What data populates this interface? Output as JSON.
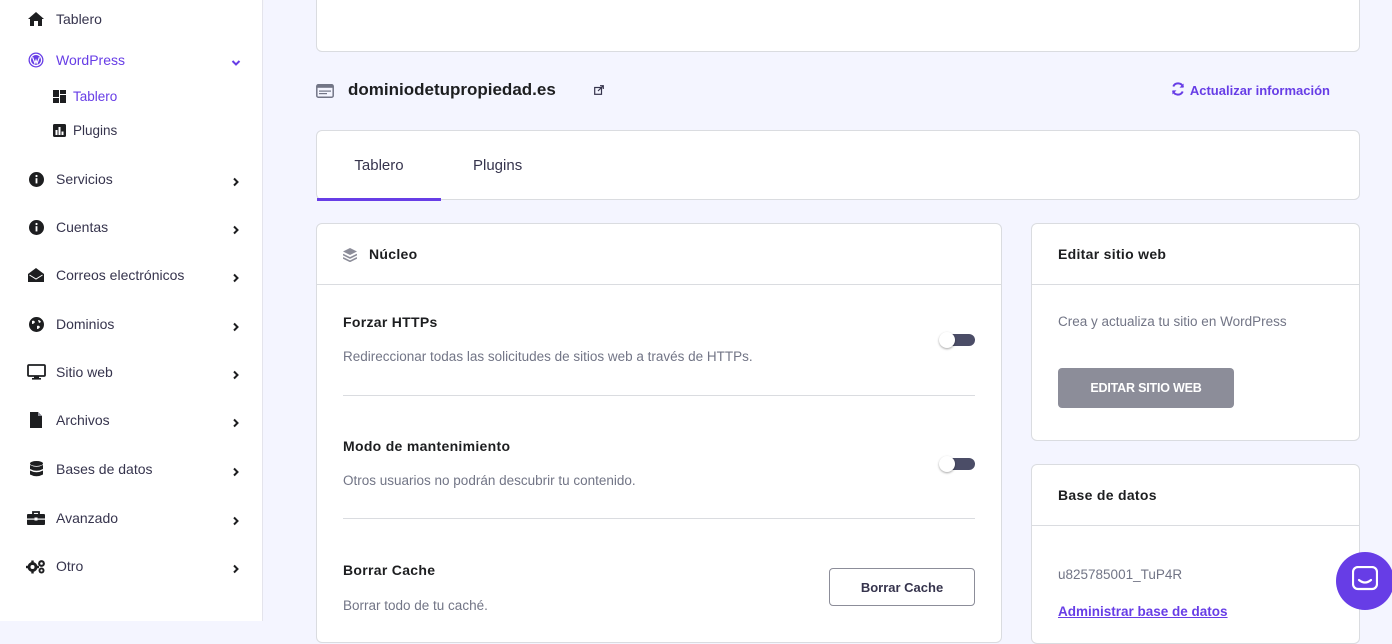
{
  "sidebar": {
    "items": [
      {
        "label": "Tablero",
        "icon": "home-icon"
      },
      {
        "label": "WordPress",
        "icon": "wordpress-icon"
      },
      {
        "label": "Servicios",
        "icon": "info-icon"
      },
      {
        "label": "Cuentas",
        "icon": "info-icon"
      },
      {
        "label": "Correos electrónicos",
        "icon": "envelope-open-icon"
      },
      {
        "label": "Dominios",
        "icon": "globe-icon"
      },
      {
        "label": "Sitio web",
        "icon": "monitor-icon"
      },
      {
        "label": "Archivos",
        "icon": "file-icon"
      },
      {
        "label": "Bases de datos",
        "icon": "database-icon"
      },
      {
        "label": "Avanzado",
        "icon": "toolbox-icon"
      },
      {
        "label": "Otro",
        "icon": "gears-icon"
      }
    ],
    "wordpress_sub": [
      {
        "label": "Tablero",
        "icon": "dashboard-icon"
      },
      {
        "label": "Plugins",
        "icon": "chart-icon"
      }
    ]
  },
  "header": {
    "domain": "dominiodetupropiedad.es",
    "refresh_label": "Actualizar información"
  },
  "tabs": [
    {
      "label": "Tablero",
      "active": true
    },
    {
      "label": "Plugins",
      "active": false
    }
  ],
  "core": {
    "title": "Núcleo",
    "options": [
      {
        "title": "Forzar HTTPs",
        "desc": "Redireccionar todas las solicitudes de sitios web a través de HTTPs.",
        "enabled": false
      },
      {
        "title": "Modo de mantenimiento",
        "desc": "Otros usuarios no podrán descubrir tu contenido.",
        "enabled": false
      },
      {
        "title": "Borrar Cache",
        "desc": "Borrar todo de tu caché.",
        "button": "Borrar Cache"
      }
    ]
  },
  "edit_site": {
    "title": "Editar sitio web",
    "desc": "Crea y actualiza tu sitio en WordPress",
    "button": "EDITAR SITIO WEB"
  },
  "database": {
    "title": "Base de datos",
    "name": "u825785001_TuP4R",
    "link": "Administrar base de datos"
  },
  "colors": {
    "accent": "#673de6",
    "text": "#36344d",
    "muted": "#727586",
    "toggle": "#4b4d67"
  }
}
